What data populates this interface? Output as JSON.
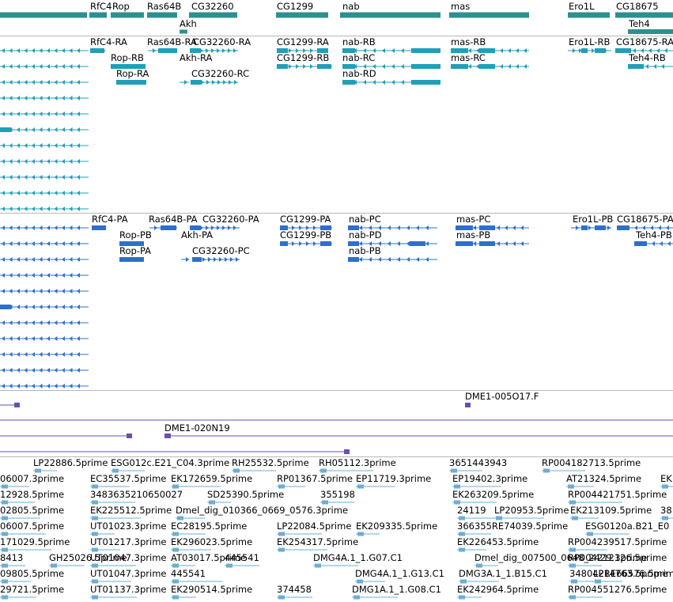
{
  "colors": {
    "gene": "#2f8f8f",
    "transcript_teal": "#1fa0b8",
    "protein_blue": "#2f6fcc",
    "clone_purple": "#6a4fb0",
    "est_lightblue": "#6aaed6",
    "separator": "#b8b8b8"
  },
  "tracks": {
    "genes": {
      "names": [
        "RfC4",
        "Rop",
        "Ras64B",
        "CG32260",
        "CG1299",
        "nab",
        "mas",
        "Ero1L",
        "CG18675",
        "Akh",
        "Teh4"
      ]
    },
    "transcripts": {
      "names": [
        "RfC4-RA",
        "Ras64B-RA",
        "CG32260-RA",
        "CG1299-RA",
        "nab-RB",
        "mas-RB",
        "Ero1L-RB",
        "CG18675-RA",
        "Rop-RB",
        "CG1299-RB",
        "nab-RC",
        "mas-RC",
        "Teh4-RB",
        "Rop-RA",
        "Akh-RA",
        "CG32260-RC",
        "nab-RD"
      ]
    },
    "proteins": {
      "names": [
        "RfC4-PA",
        "Ras64B-PA",
        "CG32260-PA",
        "CG1299-PA",
        "nab-PC",
        "mas-PC",
        "Ero1L-PB",
        "CG18675-PA",
        "Rop-PB",
        "Akh-PA",
        "CG1299-PB",
        "nab-PD",
        "mas-PB",
        "Teh4-PB",
        "Rop-PA",
        "CG32260-PC",
        "nab-PB"
      ]
    },
    "clones": {
      "names": [
        "DME1-005O17.F",
        "DME1-020N19"
      ]
    },
    "ests": {
      "rows": [
        [
          "LP22886.5prime",
          "ESG012c.E21_C04.3prime",
          "RH25532.5prime",
          "RH05112.3prime",
          "3651443943",
          "RP004182713.5prime"
        ],
        [
          "06007.3prime",
          "EC35537.5prime",
          "EK172659.5prime",
          "RP01367.5prime",
          "EP11719.3prime",
          "EP19402.3prime",
          "AT21324.5prime",
          "EK"
        ],
        [
          "12928.5prime",
          "3483635210650027",
          "SD25390.5prime",
          "355198",
          "EK263209.5prime",
          "RP004421751.5prime"
        ],
        [
          "02805.5prime",
          "EK225512.5prime",
          "Dmel_dig_010366_0669_0576.3prime",
          "24119",
          "LP20953.5prime",
          "EK213109.5prime",
          "38"
        ],
        [
          "06007.5prime",
          "UT01023.3prime",
          "EC28195.5prime",
          "LP22084.5prime",
          "EK209335.5prime",
          "366355RE74039.5prime",
          "ESG0120a.B21_E0"
        ],
        [
          "171029.5prime",
          "UT01217.3prime",
          "EK296023.5prime",
          "EK254317.5prime",
          "EK226453.5prime",
          "RP004239517.5prime"
        ],
        [
          "8413",
          "GH25026.5prime",
          "UT01047.3prime",
          "AT03017.5prime",
          "445541",
          "DMG4A.1_1.G07.C1",
          "Dmel_dig_007500_0648_2429.3prime",
          "RP004212126.5prime"
        ],
        [
          "09805.5prime",
          "UT01047.3prime",
          "445541",
          "DMG4A.1_1.G13.C1",
          "DMG3A.1_1.B15.C1",
          "348042RE66576.5prime",
          "LP14763.5prime"
        ],
        [
          "29721.5prime",
          "UT01137.3prime",
          "EK290514.5prime",
          "374458",
          "DMG1A.1_1.G08.C1",
          "EK242964.5prime",
          "RP004551276.5prime"
        ]
      ]
    }
  }
}
